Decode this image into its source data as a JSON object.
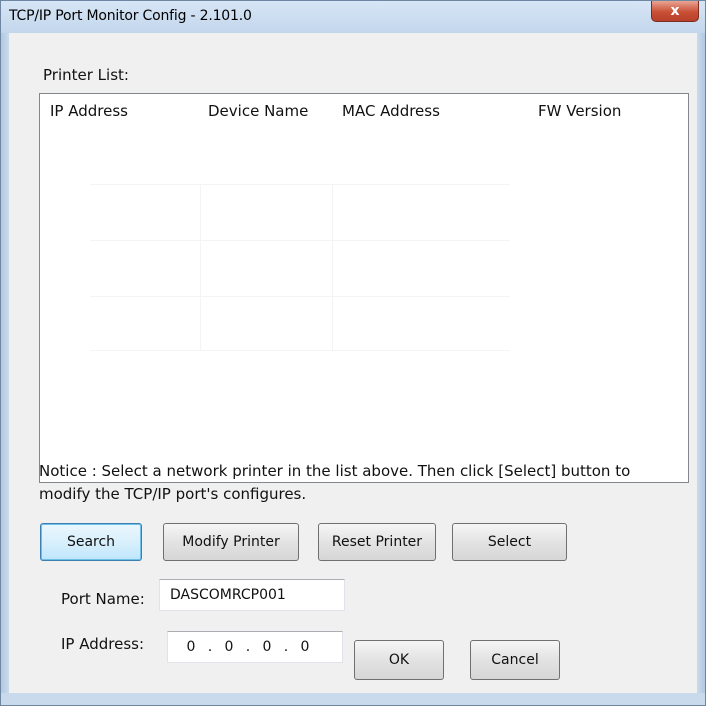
{
  "window": {
    "title": "TCP/IP Port Monitor Config - 2.101.0",
    "close_glyph": "x"
  },
  "printer_list": {
    "label": "Printer List:",
    "columns": [
      "IP Address",
      "Device Name",
      "MAC Address",
      "FW Version"
    ],
    "rows": []
  },
  "notice": {
    "line1": "Notice : Select a network printer in the list above. Then click [Select] button to",
    "line2": "modify the TCP/IP port's configures."
  },
  "buttons": {
    "search": "Search",
    "modify_printer": "Modify Printer",
    "reset_printer": "Reset Printer",
    "select": "Select",
    "ok": "OK",
    "cancel": "Cancel"
  },
  "port_name": {
    "label": "Port Name:",
    "value": "DASCOMRCP001"
  },
  "ip_address": {
    "label": "IP Address:",
    "octets": [
      "0",
      "0",
      "0",
      "0"
    ],
    "separator": "."
  },
  "colors": {
    "title_bar": "#c9daed",
    "close_button": "#c94f35",
    "default_button_border": "#3c7fb1",
    "dialog_background": "#f0f0f0"
  }
}
